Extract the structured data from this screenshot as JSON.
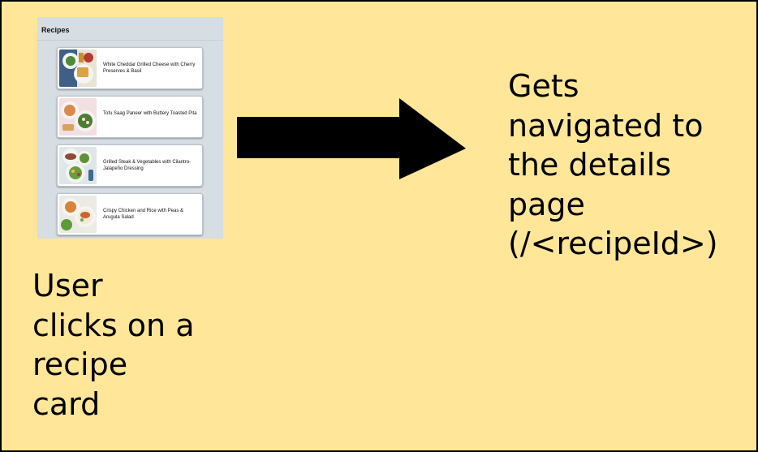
{
  "screenshot": {
    "title": "Recipes",
    "cards": [
      {
        "label": "White Cheddar Grilled Cheese with Cherry Preserves & Basil",
        "thumb_icon": "grilled-cheese-photo"
      },
      {
        "label": "Tofu Saag Paneer with Buttery Toasted Pita",
        "thumb_icon": "saag-paneer-photo"
      },
      {
        "label": "Grilled Steak & Vegetables with Cilantro-Jalapeño Dressing",
        "thumb_icon": "steak-vegetables-photo"
      },
      {
        "label": "Crispy Chicken and Rice with Peas & Arugula Salad",
        "thumb_icon": "chicken-rice-photo"
      }
    ]
  },
  "arrow_icon": "right-arrow-icon",
  "result_caption": "Gets\nnavigated to\nthe details\npage\n(/<recipeId>)",
  "action_caption": "User\nclicks on a\nrecipe\ncard",
  "colors": {
    "background": "#ffe699",
    "arrow": "#000000",
    "screenshot_bg": "#d6dde3"
  }
}
